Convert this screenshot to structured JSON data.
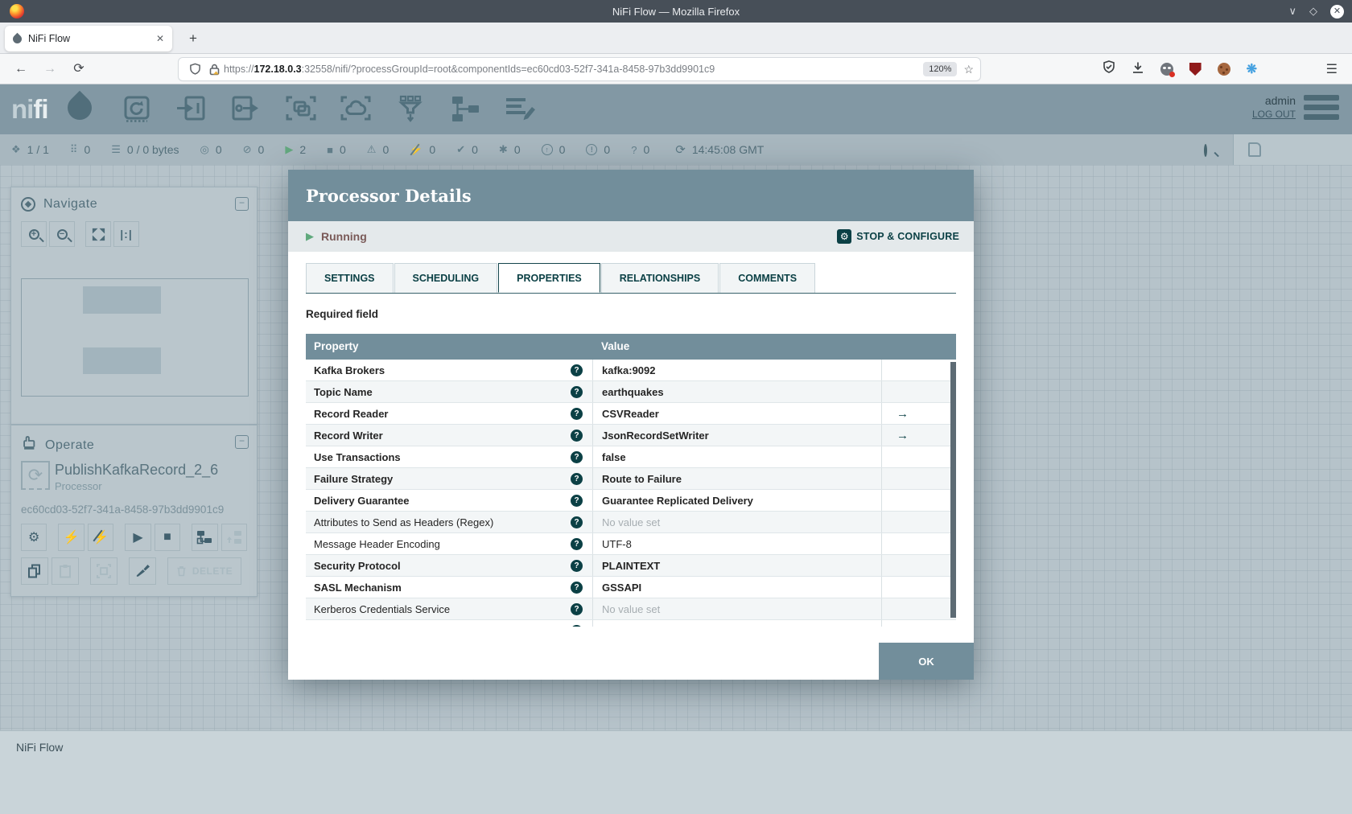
{
  "browser": {
    "window_title": "NiFi Flow — Mozilla Firefox",
    "tab_title": "NiFi Flow",
    "new_tab_label": "+",
    "url_scheme": "https://",
    "url_host": "172.18.0.3",
    "url_rest": ":32558/nifi/?processGroupId=root&componentIds=ec60cd03-52f7-341a-8458-97b3dd9901c9",
    "zoom_badge": "120%"
  },
  "nifi_header": {
    "logo_text_1": "ni",
    "logo_text_2": "fi",
    "user": "admin",
    "logout_label": "LOG OUT",
    "toolbar_icons": [
      "processor",
      "input-port",
      "output-port",
      "process-group",
      "remote-process-group",
      "funnel",
      "template",
      "label"
    ]
  },
  "statusbar": {
    "items": [
      {
        "name": "cluster",
        "glyph": "❖",
        "value": "1 / 1"
      },
      {
        "name": "threads",
        "glyph": "⠿",
        "value": "0"
      },
      {
        "name": "queued",
        "glyph": "☰",
        "value": "0 / 0 bytes"
      },
      {
        "name": "transmitting",
        "glyph": "◎",
        "value": "0"
      },
      {
        "name": "not-transmitting",
        "glyph": "⊘",
        "value": "0"
      },
      {
        "name": "running",
        "glyph": "▶",
        "value": "2"
      },
      {
        "name": "stopped",
        "glyph": "■",
        "value": "0"
      },
      {
        "name": "invalid",
        "glyph": "⚠",
        "value": "0"
      },
      {
        "name": "disabled",
        "glyph": "⚡",
        "value": "0",
        "slashed": true
      },
      {
        "name": "up-to-date",
        "glyph": "✔",
        "value": "0"
      },
      {
        "name": "locally-modified",
        "glyph": "✱",
        "value": "0"
      },
      {
        "name": "stale",
        "glyph": "↑",
        "value": "0",
        "circled": true
      },
      {
        "name": "locally-modified-stale",
        "glyph": "!",
        "value": "0",
        "circled": true
      },
      {
        "name": "sync-failure",
        "glyph": "?",
        "value": "0"
      }
    ],
    "time": "14:45:08 GMT"
  },
  "navigate": {
    "title": "Navigate"
  },
  "operate": {
    "title": "Operate",
    "component_name": "PublishKafkaRecord_2_6",
    "component_type": "Processor",
    "component_id": "ec60cd03-52f7-341a-8458-97b3dd9901c9",
    "delete_label": "DELETE"
  },
  "dialog": {
    "title": "Processor Details",
    "status": "Running",
    "action_label": "STOP & CONFIGURE",
    "tabs": [
      "SETTINGS",
      "SCHEDULING",
      "PROPERTIES",
      "RELATIONSHIPS",
      "COMMENTS"
    ],
    "active_tab": "PROPERTIES",
    "required_note": "Required field",
    "table": {
      "columns": [
        "Property",
        "Value"
      ],
      "rows": [
        {
          "property": "Kafka Brokers",
          "value": "kafka:9092",
          "required": true
        },
        {
          "property": "Topic Name",
          "value": "earthquakes",
          "required": true
        },
        {
          "property": "Record Reader",
          "value": "CSVReader",
          "required": true,
          "goto": true
        },
        {
          "property": "Record Writer",
          "value": "JsonRecordSetWriter",
          "required": true,
          "goto": true
        },
        {
          "property": "Use Transactions",
          "value": "false",
          "required": true
        },
        {
          "property": "Failure Strategy",
          "value": "Route to Failure",
          "required": true
        },
        {
          "property": "Delivery Guarantee",
          "value": "Guarantee Replicated Delivery",
          "required": true
        },
        {
          "property": "Attributes to Send as Headers (Regex)",
          "value": "No value set",
          "unset": true
        },
        {
          "property": "Message Header Encoding",
          "value": "UTF-8"
        },
        {
          "property": "Security Protocol",
          "value": "PLAINTEXT",
          "required": true
        },
        {
          "property": "SASL Mechanism",
          "value": "GSSAPI",
          "required": true
        },
        {
          "property": "Kerberos Credentials Service",
          "value": "No value set",
          "unset": true
        },
        {
          "property": "",
          "value": "",
          "partial": true
        }
      ]
    },
    "ok_label": "OK"
  },
  "breadcrumb": "NiFi Flow",
  "colors": {
    "accent": "#728e9b",
    "teal_dark": "#004849",
    "running_green": "#5fa97c",
    "chrome_dark": "#474f58",
    "canvas": "#b6c3ca"
  }
}
